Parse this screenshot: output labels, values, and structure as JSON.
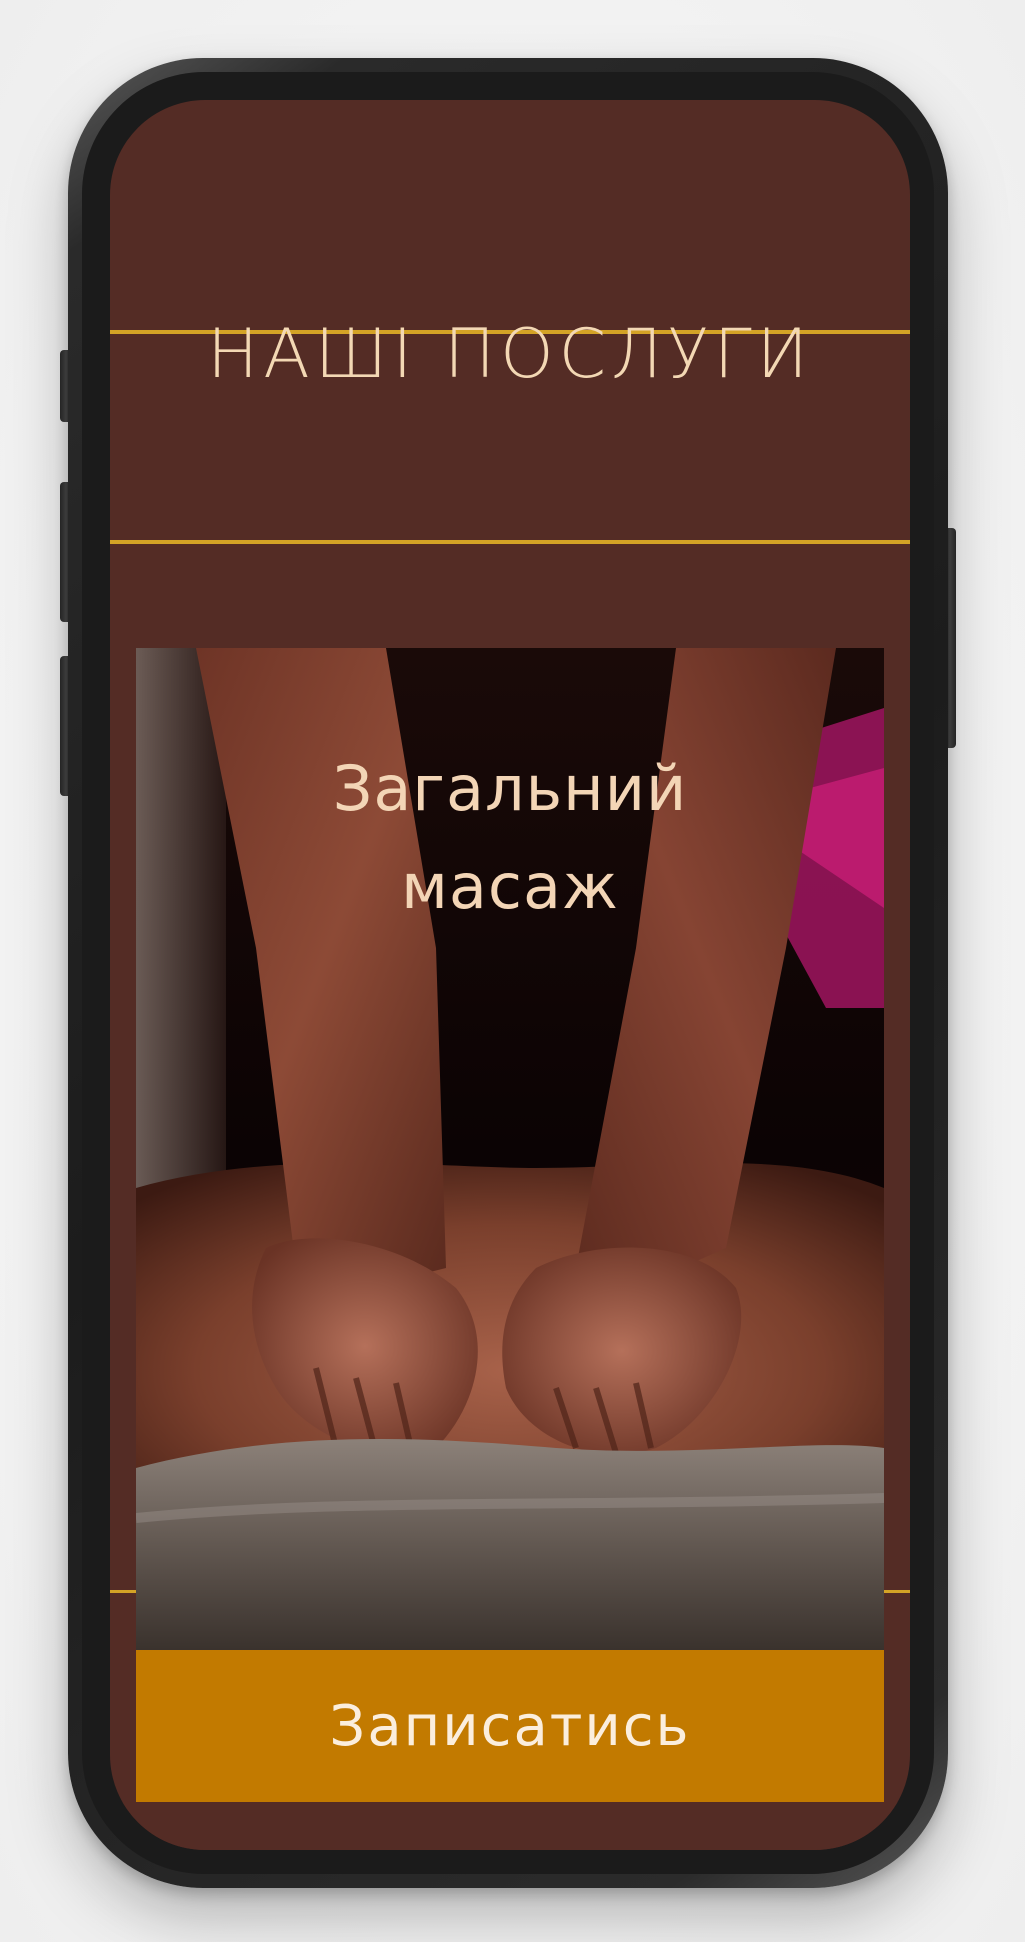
{
  "page": {
    "heading": "НАШІ ПОСЛУГИ"
  },
  "service_card": {
    "title_line1": "Загальний",
    "title_line2": "масаж",
    "image_subject": "massage-photo"
  },
  "actions": {
    "book_label": "Записатись"
  },
  "colors": {
    "background": "#542c25",
    "accent_gold": "#d4a326",
    "button": "#c27a00",
    "heading_text": "#f3d8b4"
  }
}
